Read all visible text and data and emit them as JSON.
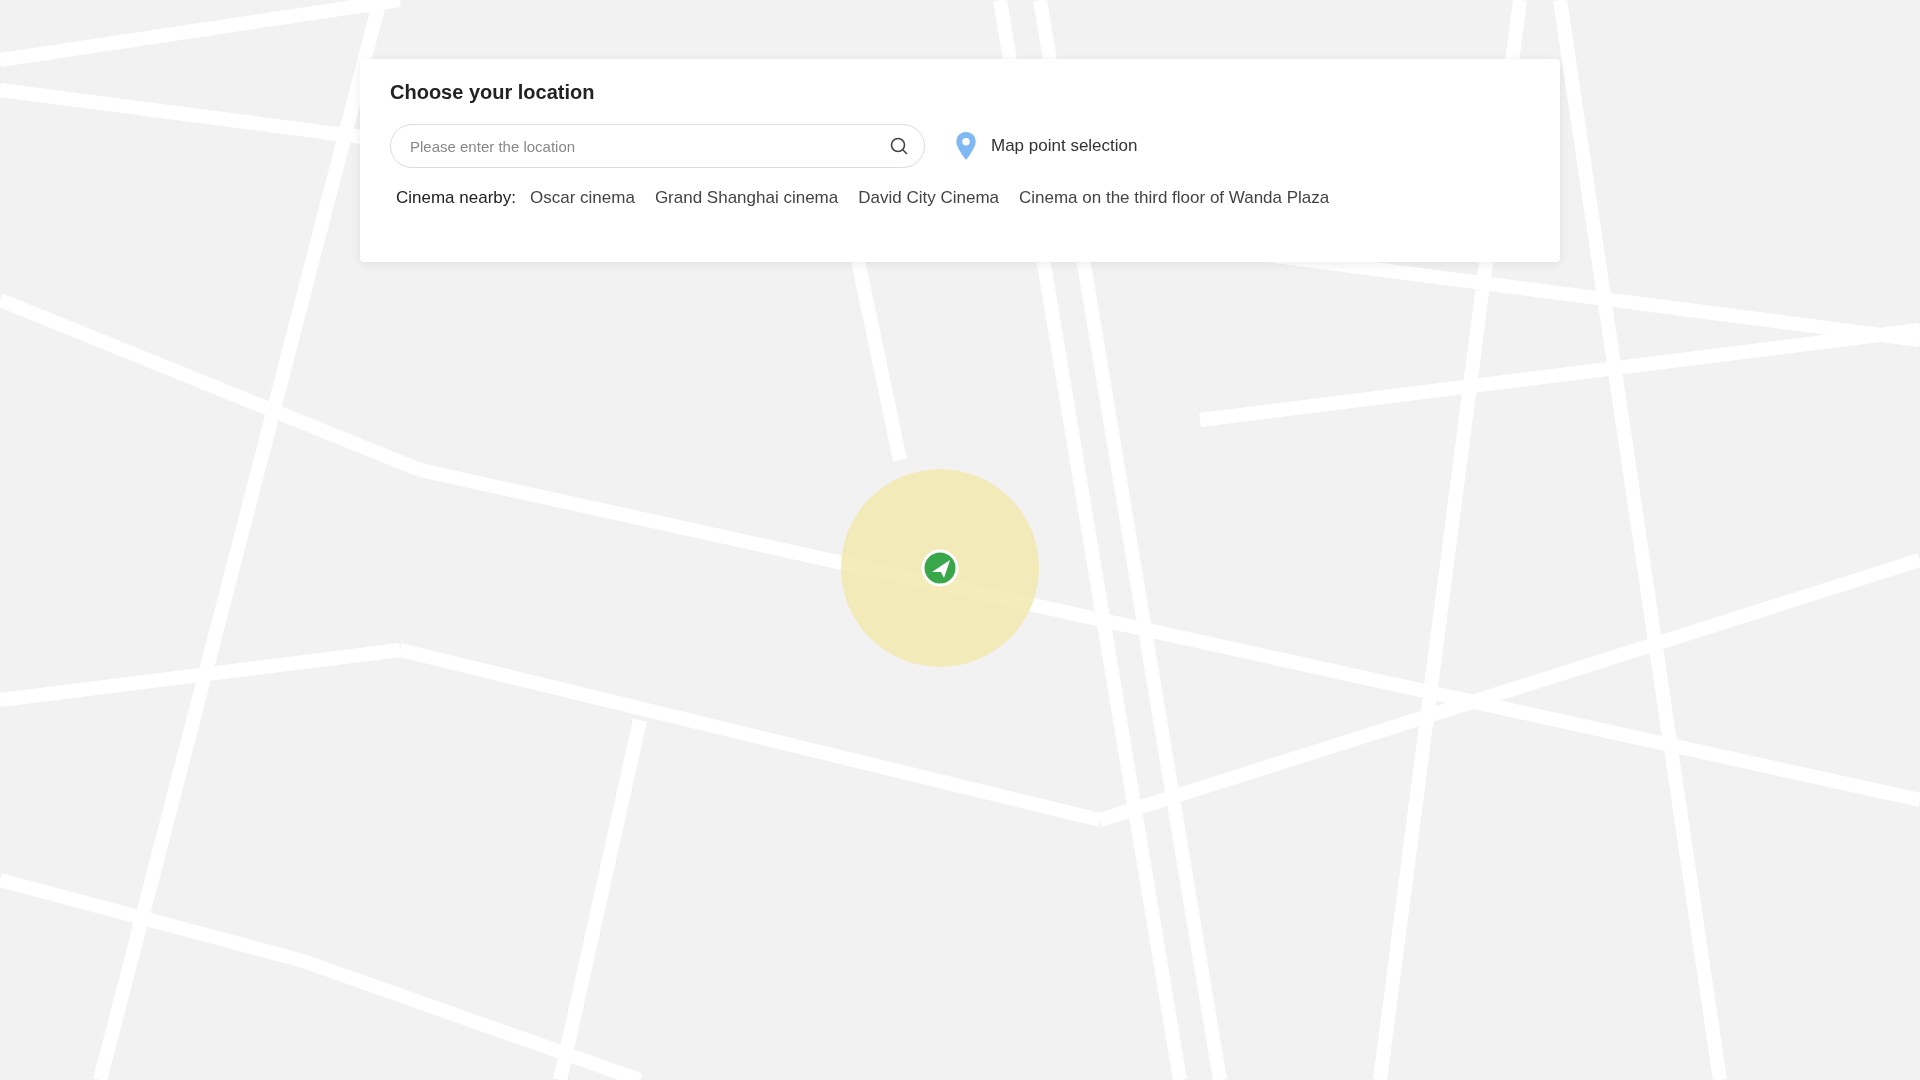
{
  "panel": {
    "title": "Choose your location",
    "search": {
      "placeholder": "Please enter the location"
    },
    "map_point_label": "Map point selection",
    "nearby_label": "Cinema nearby:",
    "cinemas": [
      "Oscar cinema",
      "Grand Shanghai cinema",
      "David City Cinema",
      "Cinema on the third floor of Wanda Plaza"
    ]
  }
}
